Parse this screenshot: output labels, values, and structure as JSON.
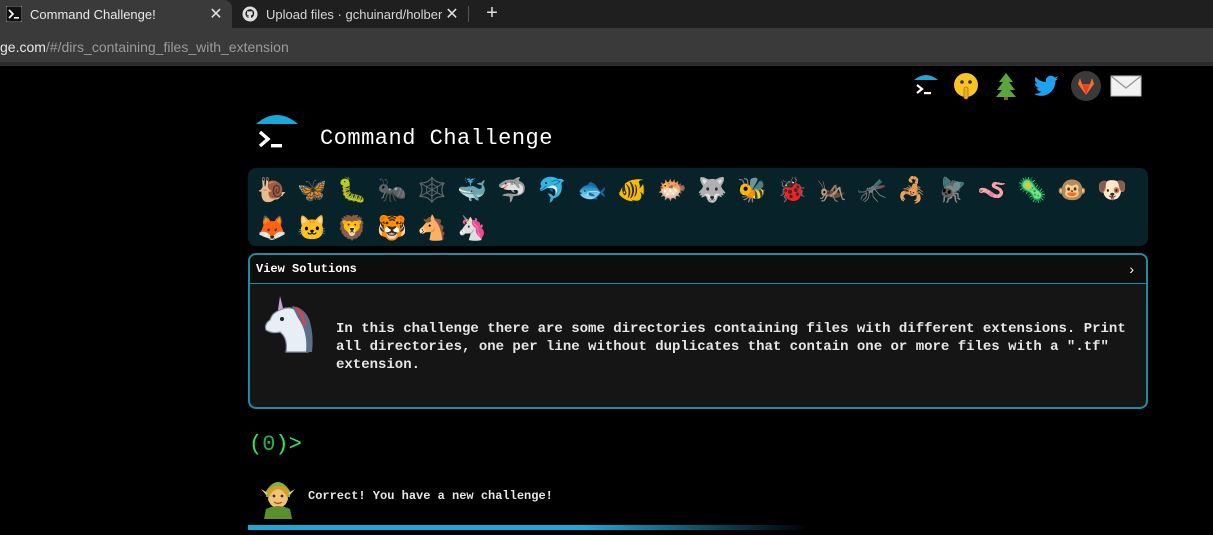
{
  "browser": {
    "tabs": [
      {
        "title": "Command Challenge!",
        "favicon": "terminal-icon",
        "active": true
      },
      {
        "title": "Upload files · gchuinard/holberton",
        "favicon": "github-icon",
        "active": false
      }
    ],
    "close_glyph": "✕",
    "new_tab_glyph": "+",
    "url_host": "ge.com",
    "url_path": "/#/dirs_containing_files_with_extension"
  },
  "header": {
    "title": "Command Challenge",
    "logo_icon": "terminal-umbrella-logo"
  },
  "social_icons": [
    "terminal-icon",
    "shushing-face-icon",
    "tree-icon",
    "twitter-icon",
    "gitlab-icon",
    "mail-icon"
  ],
  "animals_row1": [
    "🐌",
    "🦋",
    "🐛",
    "🐜",
    "🕸️",
    "🐳",
    "🦈",
    "🐬",
    "🐟",
    "🐠",
    "🐡",
    "🐺",
    "🐝",
    "🐞",
    "🦗",
    "🦟",
    "🦂",
    "🪰",
    "🪱",
    "🦠",
    "🐵",
    "🐶"
  ],
  "animals_row2": [
    "🦊",
    "🐱",
    "🦁",
    "🐯",
    "🐴",
    "🦄"
  ],
  "panel": {
    "header_label": "View Solutions",
    "chevron": "›",
    "challenge_text": "In this challenge there are some directories containing files with different extensions. Print all directories, one per line without duplicates that contain one or more files with a \".tf\" extension."
  },
  "prompt": {
    "open": "(",
    "count": "0",
    "close": ")>"
  },
  "feedback": {
    "message": "Correct! You have a new challenge!",
    "icon": "elf-icon"
  },
  "colors": {
    "accent": "#1f8ba3",
    "prompt_green": "#2ee65c",
    "progress": "#1aa8d8"
  }
}
